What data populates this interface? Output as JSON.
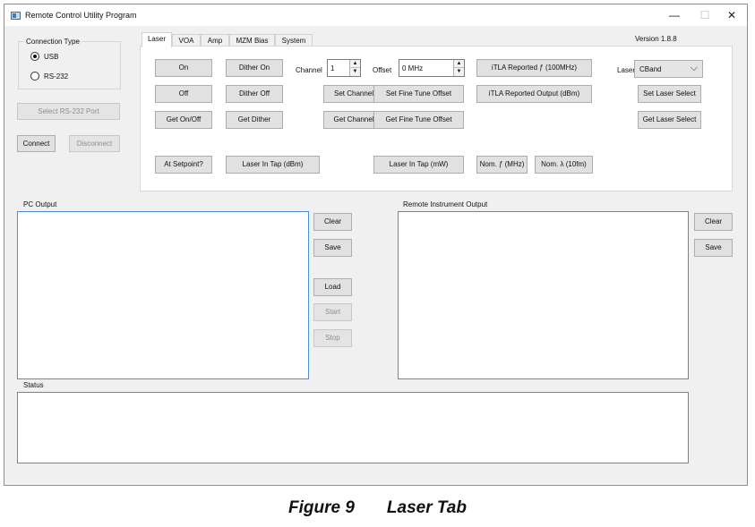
{
  "window": {
    "title": "Remote Control Utility Program",
    "minimize": "—",
    "maximize": "☐",
    "close": "✕"
  },
  "connection": {
    "group_title": "Connection Type",
    "options": [
      "USB",
      "RS-232"
    ],
    "selected": "USB",
    "select_port": "Select RS-232 Port",
    "connect": "Connect",
    "disconnect": "Disconnect"
  },
  "tabs": [
    "Laser",
    "VOA",
    "Amp",
    "MZM Bias",
    "System"
  ],
  "active_tab": "Laser",
  "version": "Version 1.8.8",
  "laser": {
    "on": "On",
    "off": "Off",
    "get_on_off": "Get On/Off",
    "dither_on": "Dither On",
    "dither_off": "Dither Off",
    "get_dither": "Get Dither",
    "channel_label": "Channel",
    "channel_value": "1",
    "set_channel": "Set Channel",
    "get_channel": "Get Channel",
    "offset_label": "Offset",
    "offset_value": "0 MHz",
    "set_fine_tune": "Set Fine Tune Offset",
    "get_fine_tune": "Get Fine Tune Offset",
    "itla_freq": "iTLA Reported ƒ (100MHz)",
    "itla_output": "iTLA Reported Output (dBm)",
    "laser_label": "Laser",
    "laser_select_value": "CBand",
    "set_laser_select": "Set Laser Select",
    "get_laser_select": "Get Laser Select",
    "at_setpoint": "At Setpoint?",
    "laser_in_tap_dbm": "Laser In Tap (dBm)",
    "laser_in_tap_mw": "Laser In Tap (mW)",
    "nom_freq": "Nom. ƒ (MHz)",
    "nom_lambda": "Nom. λ (10fm)"
  },
  "pc_output": {
    "label": "PC Output",
    "clear": "Clear",
    "save": "Save",
    "load": "Load",
    "start": "Start",
    "stop": "Stop"
  },
  "remote_output": {
    "label": "Remote Instrument Output",
    "clear": "Clear",
    "save": "Save"
  },
  "status": {
    "label": "Status"
  },
  "caption": {
    "figure": "Figure 9",
    "title": "Laser Tab"
  }
}
